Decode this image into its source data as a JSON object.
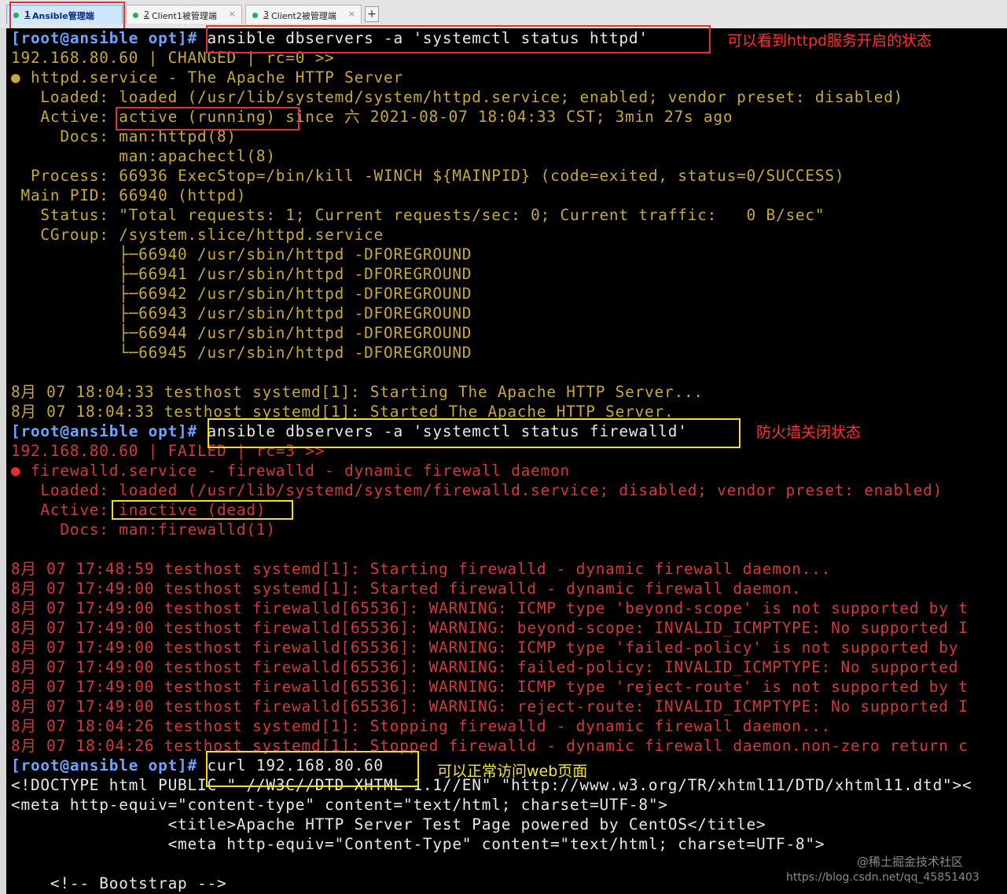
{
  "tabs": [
    {
      "num": "1",
      "label": " Ansible管理端",
      "close": ""
    },
    {
      "num": "2",
      "label": " Client1被管理端",
      "close": "×"
    },
    {
      "num": "3",
      "label": " Client2被管理端",
      "close": "×"
    }
  ],
  "new_tab": "+",
  "terminal": {
    "httpd": {
      "prompt": "[root@ansible opt]#",
      "command": " ansible dbservers -a 'systemctl status httpd'",
      "result": "192.168.80.60 | CHANGED | rc=0 >>",
      "bullet": "●",
      "unit": " httpd.service - The Apache HTTP Server",
      "loaded": "   Loaded: loaded (/usr/lib/systemd/system/httpd.service; enabled; vendor preset: disabled)",
      "active_label": "   Active: ",
      "active_state": "active (running)",
      "active_rest": " since 六 2021-08-07 18:04:33 CST; 3min 27s ago",
      "docs1": "     Docs: man:httpd(8)",
      "docs2": "           man:apachectl(8)",
      "process": "  Process: 66936 ExecStop=/bin/kill -WINCH ${MAINPID} (code=exited, status=0/SUCCESS)",
      "mainpid": " Main PID: 66940 (httpd)",
      "status": "   Status: \"Total requests: 1; Current requests/sec: 0; Current traffic:   0 B/sec\"",
      "cgroup": "   CGroup: /system.slice/httpd.service",
      "tree": [
        "           ├─66940 /usr/sbin/httpd -DFOREGROUND",
        "           ├─66941 /usr/sbin/httpd -DFOREGROUND",
        "           ├─66942 /usr/sbin/httpd -DFOREGROUND",
        "           ├─66943 /usr/sbin/httpd -DFOREGROUND",
        "           ├─66944 /usr/sbin/httpd -DFOREGROUND",
        "           └─66945 /usr/sbin/httpd -DFOREGROUND"
      ],
      "log": [
        "8月 07 18:04:33 testhost systemd[1]: Starting The Apache HTTP Server...",
        "8月 07 18:04:33 testhost systemd[1]: Started The Apache HTTP Server."
      ]
    },
    "firewalld": {
      "prompt": "[root@ansible opt]#",
      "command": " ansible dbservers -a 'systemctl status firewalld'",
      "result": "192.168.80.60 | FAILED | rc=3 >>",
      "bullet": "●",
      "unit": " firewalld.service - firewalld - dynamic firewall daemon",
      "loaded": "   Loaded: loaded (/usr/lib/systemd/system/firewalld.service; disabled; vendor preset: enabled)",
      "active_label": "   Active: ",
      "active_state": "inactive (dead)",
      "docs": "     Docs: man:firewalld(1)",
      "log": [
        "8月 07 17:48:59 testhost systemd[1]: Starting firewalld - dynamic firewall daemon...",
        "8月 07 17:49:00 testhost systemd[1]: Started firewalld - dynamic firewall daemon.",
        "8月 07 17:49:00 testhost firewalld[65536]: WARNING: ICMP type 'beyond-scope' is not supported by t",
        "8月 07 17:49:00 testhost firewalld[65536]: WARNING: beyond-scope: INVALID_ICMPTYPE: No supported I",
        "8月 07 17:49:00 testhost firewalld[65536]: WARNING: ICMP type 'failed-policy' is not supported by",
        "8月 07 17:49:00 testhost firewalld[65536]: WARNING: failed-policy: INVALID_ICMPTYPE: No supported",
        "8月 07 17:49:00 testhost firewalld[65536]: WARNING: ICMP type 'reject-route' is not supported by t",
        "8月 07 17:49:00 testhost firewalld[65536]: WARNING: reject-route: INVALID_ICMPTYPE: No supported I",
        "8月 07 18:04:26 testhost systemd[1]: Stopping firewalld - dynamic firewall daemon...",
        "8月 07 18:04:26 testhost systemd[1]: Stopped firewalld - dynamic firewall daemon.non-zero return c"
      ]
    },
    "curl": {
      "prompt": "[root@ansible opt]#",
      "command": " curl 192.168.80.60",
      "output": [
        "<!DOCTYPE html PUBLIC \"-//W3C//DTD XHTML 1.1//EN\" \"http://www.w3.org/TR/xhtml11/DTD/xhtml11.dtd\"><",
        "<meta http-equiv=\"content-type\" content=\"text/html; charset=UTF-8\">",
        "                <title>Apache HTTP Server Test Page powered by CentOS</title>",
        "                <meta http-equiv=\"Content-Type\" content=\"text/html; charset=UTF-8\">",
        "",
        "    <!-- Bootstrap -->"
      ]
    }
  },
  "annotations": {
    "httpd": "可以看到httpd服务开启的状态",
    "firewall": "防火墙关闭状态",
    "curl": "可以正常访问web页面"
  },
  "watermark": {
    "line1": "@稀土掘金技术社区",
    "line2": "https://blog.csdn.net/qq_45851403"
  },
  "colors": {
    "terminal_bg": "#000000",
    "normal_text": "#c7a93a",
    "error_text": "#d23a3a",
    "prompt_text": "#6fa3ff",
    "command_text": "#e8e8e8",
    "highlight_red": "#e03232",
    "highlight_yellow": "#f2e01c"
  }
}
